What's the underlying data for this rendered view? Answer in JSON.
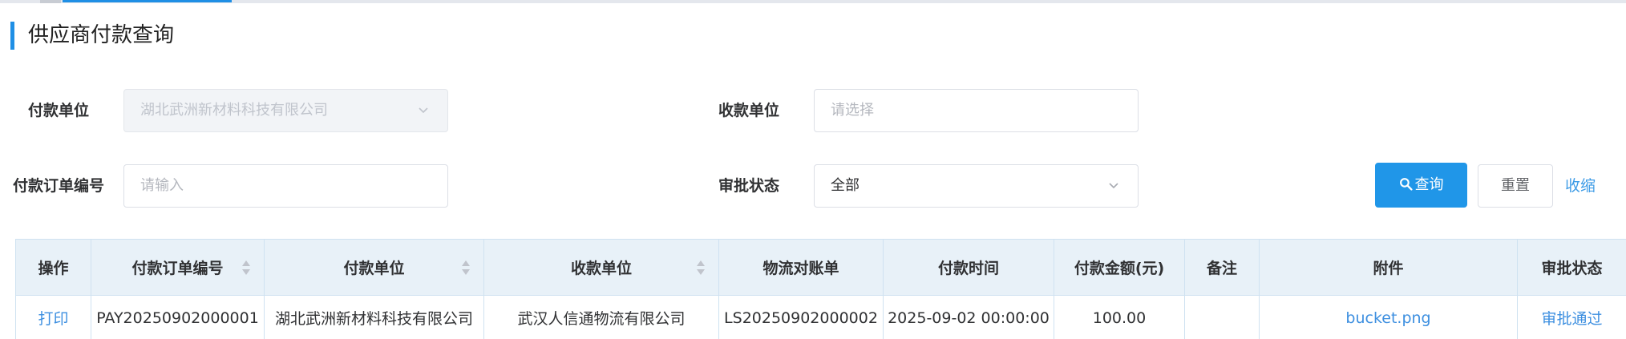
{
  "page": {
    "title": "供应商付款查询"
  },
  "filters": {
    "payer": {
      "label": "付款单位",
      "value": "湖北武洲新材料科技有限公司"
    },
    "payee": {
      "label": "收款单位",
      "placeholder": "请选择"
    },
    "order_no": {
      "label": "付款订单编号",
      "placeholder": "请输入"
    },
    "status": {
      "label": "审批状态",
      "value": "全部"
    }
  },
  "actions": {
    "search": "查询",
    "reset": "重置",
    "collapse": "收缩"
  },
  "table": {
    "columns": [
      "操作",
      "付款订单编号",
      "付款单位",
      "收款单位",
      "物流对账单",
      "付款时间",
      "付款金额(元)",
      "备注",
      "附件",
      "审批状态"
    ],
    "rows": [
      {
        "action": "打印",
        "order_no": "PAY20250902000001",
        "payer": "湖北武洲新材料科技有限公司",
        "payee": "武汉人信通物流有限公司",
        "statement": "LS20250902000002",
        "time": "2025-09-02 00:00:00",
        "amount": "100.00",
        "remark": "",
        "attachment": "bucket.png",
        "status": "审批通过"
      }
    ]
  },
  "colors": {
    "primary": "#2096e8",
    "link": "#3d8fe0",
    "header_bg": "#e8f1f8",
    "border": "#cfe2f1"
  }
}
